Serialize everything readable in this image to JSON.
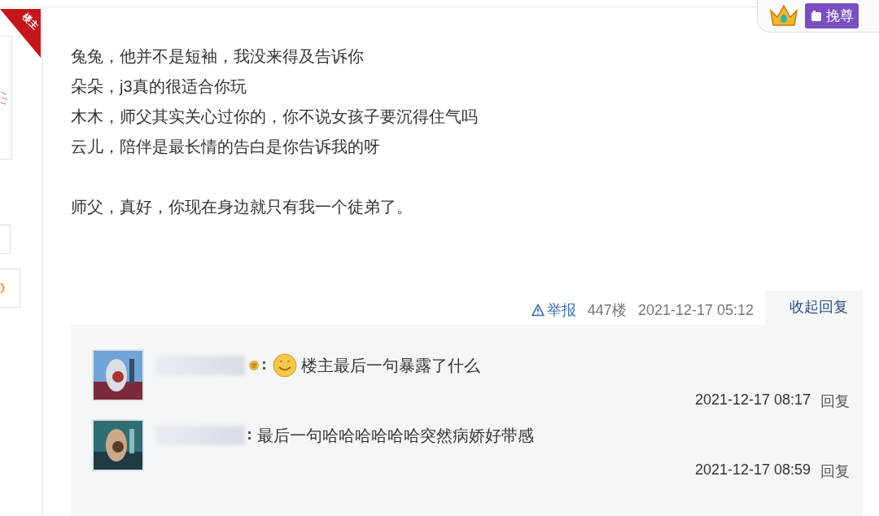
{
  "floor_badge": "楼主",
  "top_button": {
    "label": "挽尊"
  },
  "post": {
    "paragraphs": [
      "兔兔，他并不是短袖，我没来得及告诉你",
      "朵朵，j3真的很适合你玩",
      "木木，师父其实关心过你的，你不说女孩子要沉得住气吗",
      "云儿，陪伴是最长情的告白是你告诉我的呀"
    ],
    "closing": "师父，真好，你现在身边就只有我一个徒弟了。"
  },
  "meta": {
    "report": "举报",
    "floor": "447楼",
    "time": "2021-12-17 05:12",
    "collapse": "收起回复"
  },
  "replies": [
    {
      "emoji": true,
      "text": "楼主最后一句暴露了什么",
      "time": "2021-12-17 08:17",
      "action": "回复"
    },
    {
      "emoji": false,
      "text": "最后一句哈哈哈哈哈哈突然病娇好带感",
      "time": "2021-12-17 08:59",
      "action": "回复"
    }
  ]
}
